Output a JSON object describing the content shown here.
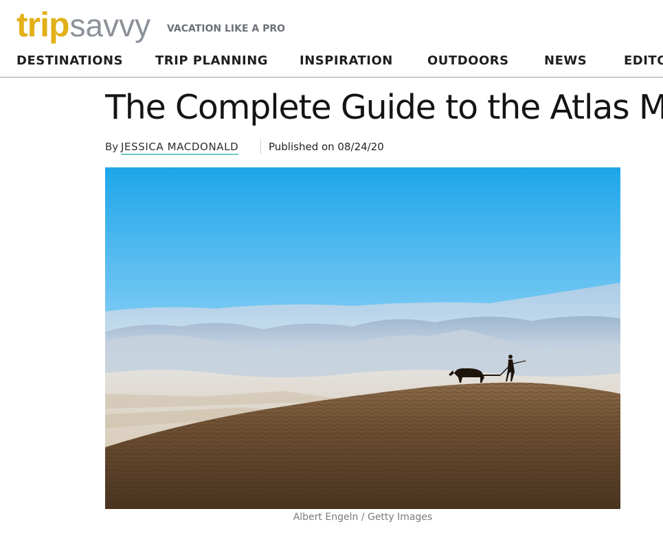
{
  "site": {
    "logo_primary": "trip",
    "logo_secondary": "savvy",
    "tagline": "VACATION LIKE A PRO",
    "brand_color": "#e2b019",
    "logo_gray": "#8c9299"
  },
  "nav": {
    "items": [
      "DESTINATIONS",
      "TRIP PLANNING",
      "INSPIRATION",
      "OUTDOORS",
      "NEWS",
      "EDITO"
    ]
  },
  "article": {
    "title": "The Complete Guide to the Atlas M",
    "by_label": "By",
    "author": "JESSICA MACDONALD",
    "published": "Published on 08/24/20",
    "author_underline_color": "#6ec6c3"
  },
  "hero": {
    "caption": "Albert Engeln / Getty Images"
  }
}
